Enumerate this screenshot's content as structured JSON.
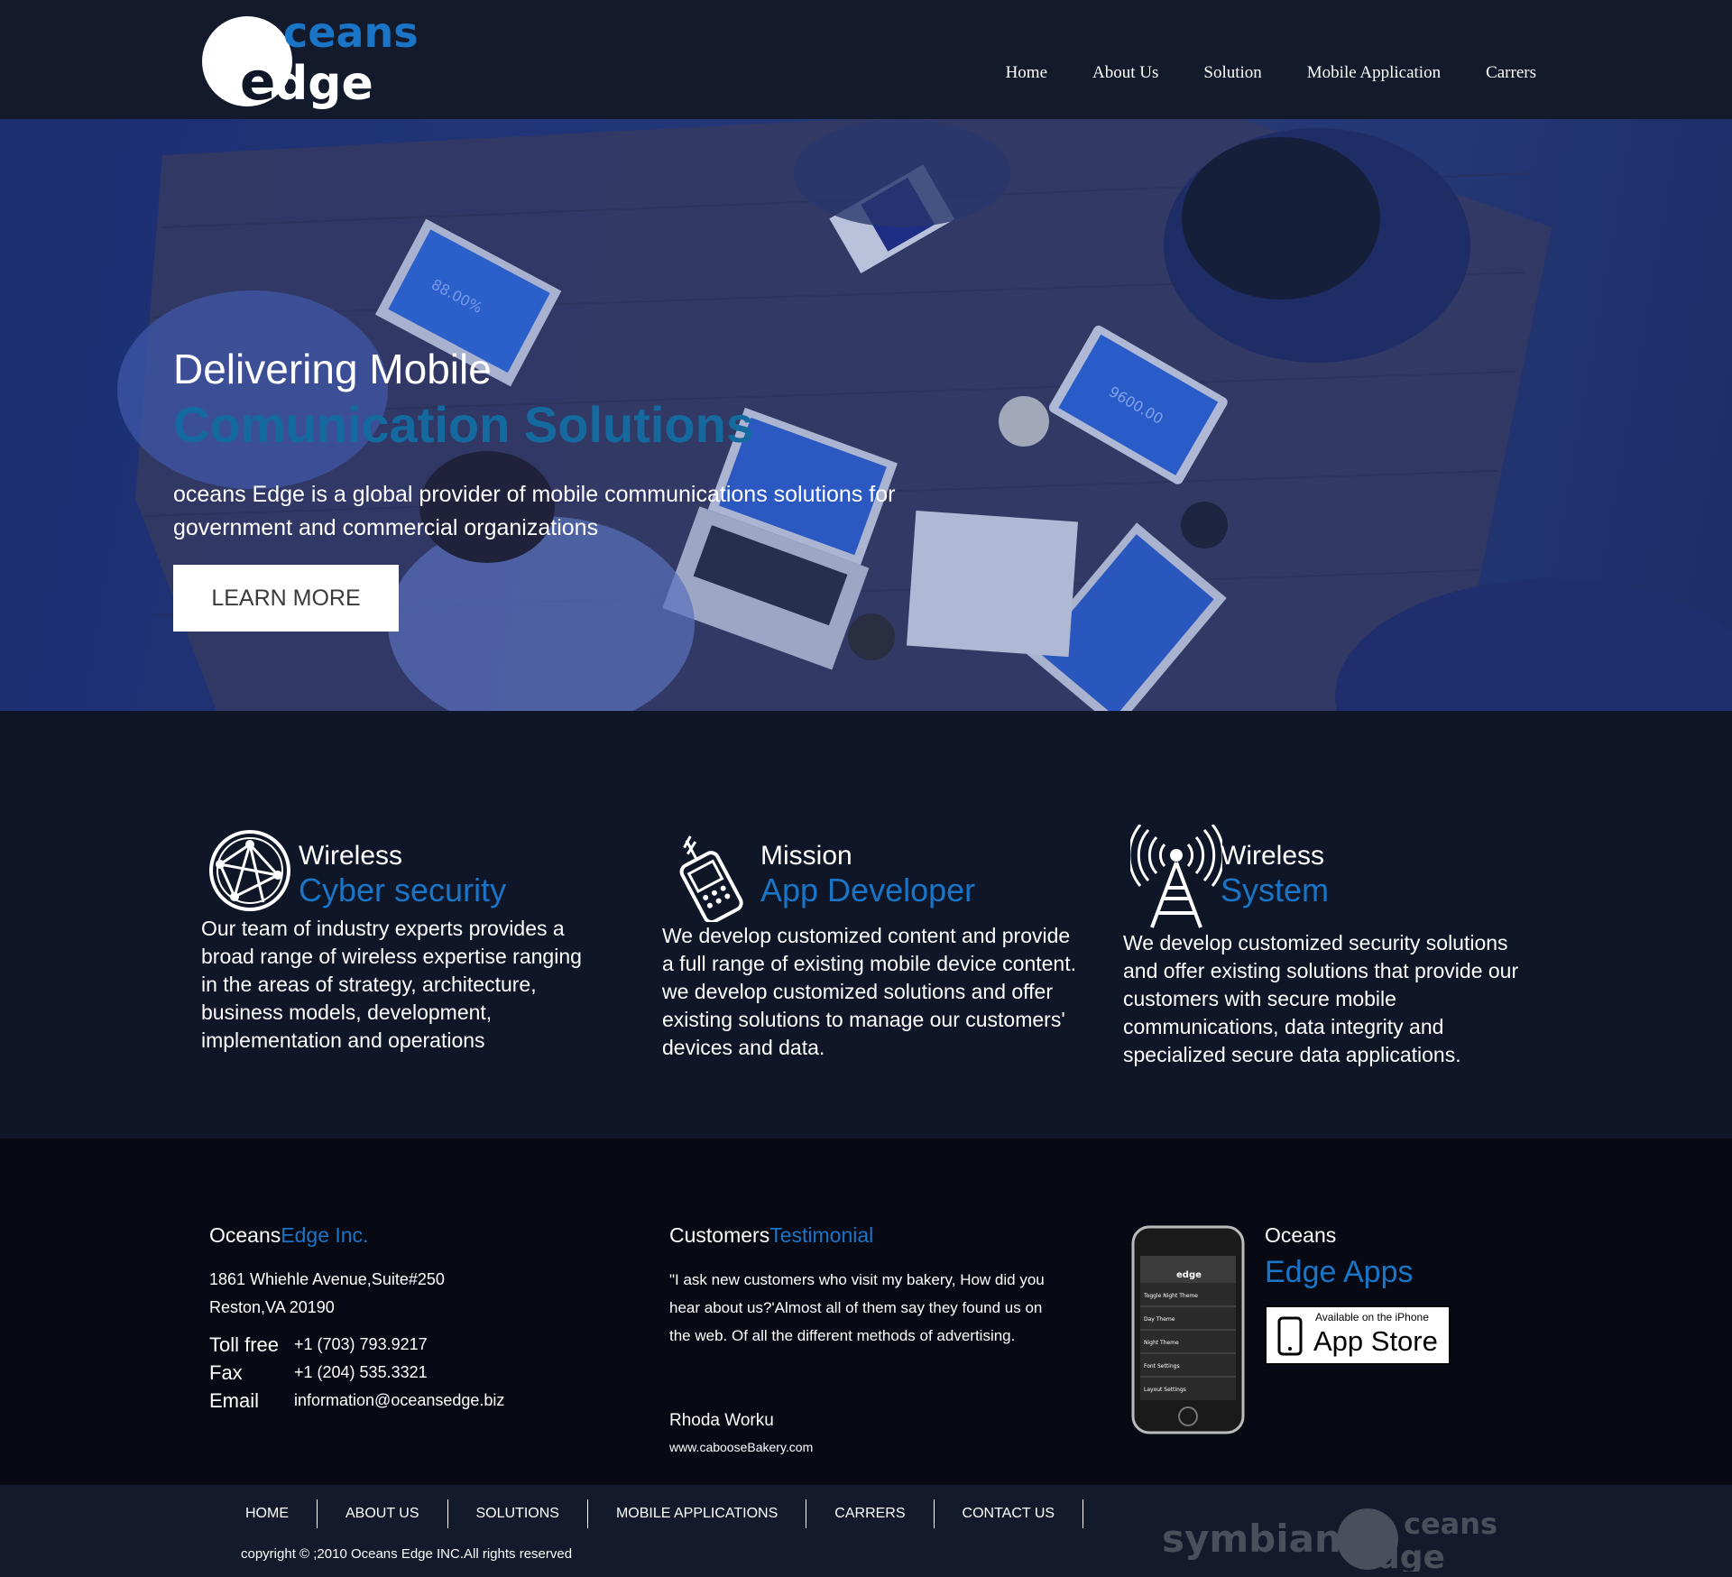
{
  "header": {
    "logo_text_top": "ceans",
    "logo_text_bottom": "dge",
    "nav": [
      "Home",
      "About Us",
      "Solution",
      "Mobile Application",
      "Carrers"
    ]
  },
  "hero": {
    "title_line1": "Delivering Mobile",
    "title_line2": "Comunication Solutions",
    "description": "oceans Edge is a global provider of mobile communications solutions for government and commercial organizations",
    "button_label": "LEARN MORE",
    "screen_text_1": "88.00%",
    "screen_text_2": "9600.00",
    "screen_text_3": "88.00%"
  },
  "features": [
    {
      "icon": "globe-network-icon",
      "title": "Wireless",
      "subtitle": "Cyber security",
      "description": "Our team of industry experts provides a broad range of wireless expertise ranging in the areas of strategy, architecture, business models, development, implementation and operations"
    },
    {
      "icon": "mobile-phone-icon",
      "title": "Mission",
      "subtitle": "App Developer",
      "description": "We develop customized content and provide a full range of existing mobile device content. we develop customized solutions and offer existing solutions to manage our customers' devices and data."
    },
    {
      "icon": "antenna-tower-icon",
      "title": "Wireless",
      "subtitle": "System",
      "description": "We develop customized security solutions and offer existing solutions that provide our customers with secure mobile communications, data integrity and specialized secure data applications."
    }
  ],
  "footer": {
    "company": {
      "name_white": "Oceans",
      "name_blue": "Edge Inc.",
      "address_line1": "1861 Whiehle Avenue,Suite#250",
      "address_line2": "Reston,VA 20190",
      "toll_free_label": "Toll free",
      "toll_free": "+1 (703) 793.9217",
      "fax_label": "Fax",
      "fax": "+1 (204) 535.3321",
      "email_label": "Email",
      "email": "information@oceansedge.biz"
    },
    "testimonial": {
      "head_white": "Customers",
      "head_blue": "Testimonial",
      "quote": "\"I ask new customers who visit my bakery, How did you hear about us?'Almost all of them say they found us on the web. Of all the different methods of advertising.",
      "author": "Rhoda Worku",
      "url": "www.cabooseBakery.com"
    },
    "apps": {
      "title1": "Oceans",
      "title2": "Edge Apps",
      "badge_small": "Available on the iPhone",
      "badge_big": "App Store",
      "phone_items": [
        "Toggle Night Theme",
        "Day Theme",
        "Night Theme",
        "Font Settings",
        "Layout Settings"
      ]
    }
  },
  "bottombar": {
    "nav": [
      "HOME",
      "ABOUT US",
      "SOLUTIONS",
      "MOBILE APPLICATIONS",
      "CARRERS",
      "CONTACT US"
    ],
    "copyright": "copyright © ;2010 Oceans Edge INC.All rights reserved",
    "symbian": "symbian",
    "logo_text_top": "ceans",
    "logo_text_bottom": "dge"
  },
  "colors": {
    "brand_blue": "#1a75c7",
    "hero_title_blue": "#146a9e",
    "background": "#0f1627",
    "footer": "#070a15"
  }
}
